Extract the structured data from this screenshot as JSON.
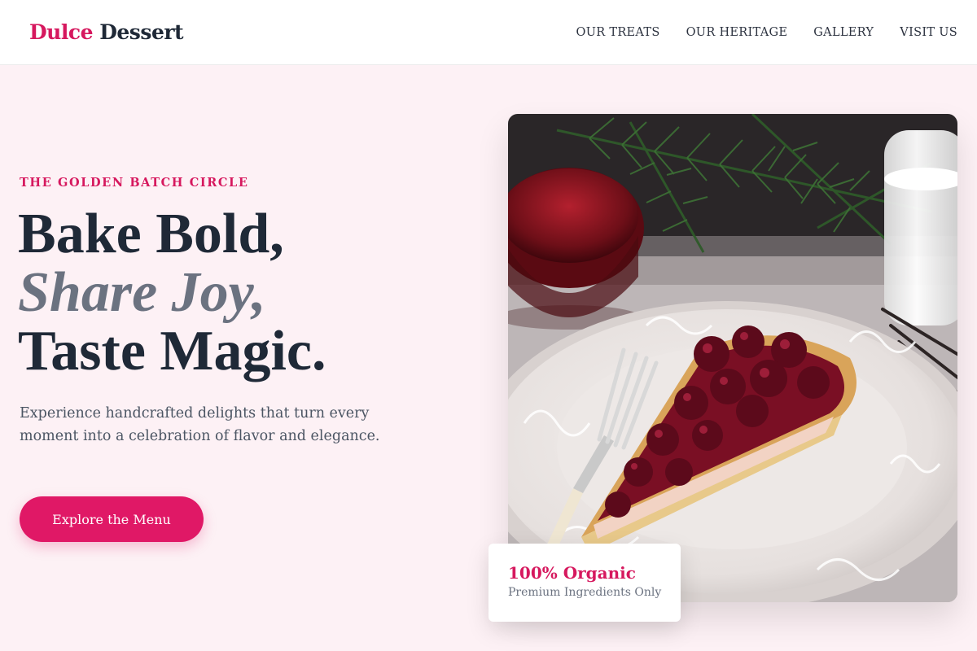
{
  "header": {
    "logo_accent": "Dulce",
    "logo_rest": "Dessert",
    "nav": [
      "OUR TREATS",
      "OUR HERITAGE",
      "GALLERY",
      "VISIT US"
    ]
  },
  "hero": {
    "eyebrow": "THE GOLDEN BATCH CIRCLE",
    "headline_line1": "Bake Bold,",
    "headline_line2": "Share Joy,",
    "headline_line3": "Taste Magic.",
    "description": "Experience handcrafted delights that turn every moment into a celebration of flavor and elegance.",
    "cta_label": "Explore the Menu",
    "image_subject": "slice of cherry tart on ornate white plate with fork, berry jam and glass of milk"
  },
  "badge": {
    "title": "100% Organic",
    "subtitle": "Premium Ingredients Only"
  },
  "colors": {
    "brand": "#d6185e",
    "button": "#e01866",
    "page_bg": "#fdf1f5",
    "heading": "#1f2937",
    "muted": "#6b7280"
  }
}
